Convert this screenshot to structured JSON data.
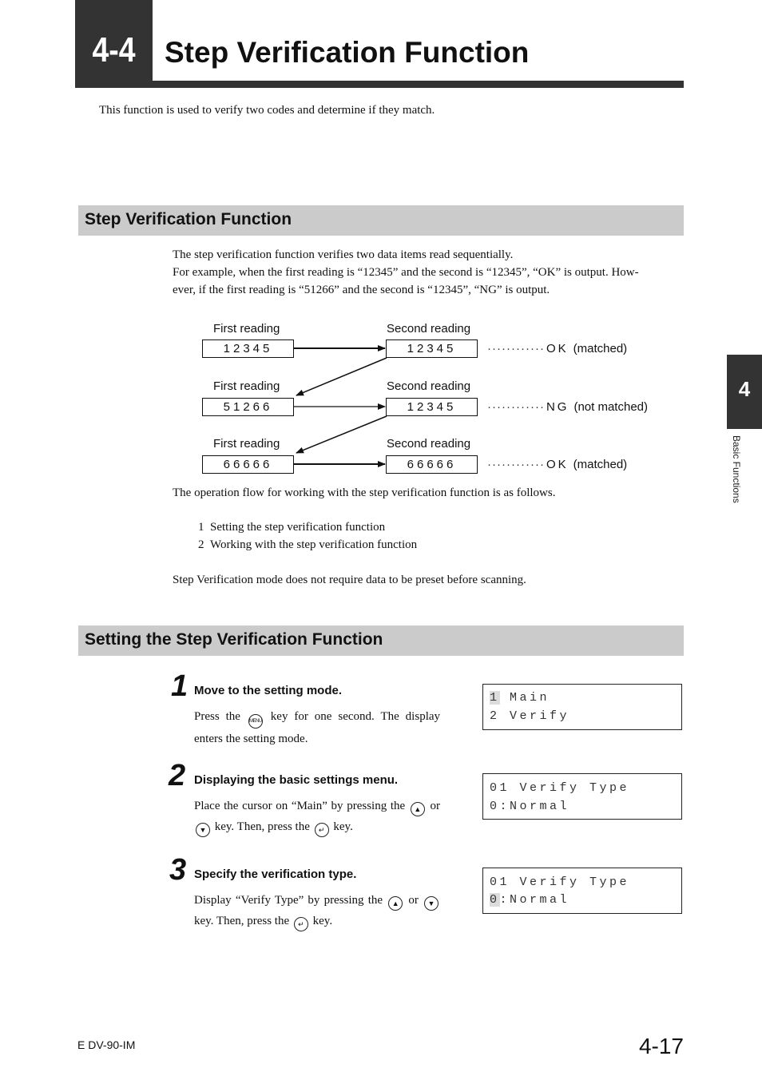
{
  "chapter": {
    "number": "4-4",
    "title": "Step Verification Function",
    "intro": "This function is used to verify two codes and determine if they match."
  },
  "section1": {
    "title": "Step Verification Function",
    "para_line1": "The step verification function verifies two data items read sequentially.",
    "para_line2": "For example, when the first reading is “12345” and the second is “12345”, “OK” is output. How-",
    "para_line3": "ever, if the first reading is “51266” and the second is “12345”, “NG” is output.",
    "diagram": {
      "first_label": "First reading",
      "second_label": "Second reading",
      "dots": "············",
      "rows": [
        {
          "first": "12345",
          "second": "12345",
          "result": "OK",
          "note": "(matched)"
        },
        {
          "first": "51266",
          "second": "12345",
          "result": "NG",
          "note": "(not matched)"
        },
        {
          "first": "66666",
          "second": "66666",
          "result": "OK",
          "note": "(matched)"
        }
      ]
    },
    "flow_intro": "The operation flow for working with the step verification function is as follows.",
    "flow_items": [
      {
        "num": "1",
        "text": "Setting the step verification function"
      },
      {
        "num": "2",
        "text": "Working with the step verification function"
      }
    ],
    "note": "Step Verification mode does not require data to be preset before scanning."
  },
  "section2": {
    "title": "Setting the Step Verification Function",
    "steps": [
      {
        "num": "1",
        "title": "Move to the setting mode.",
        "body_a": "Press the",
        "key1": "MENU",
        "body_b": "key for one second. The display enters the setting mode.",
        "lcd": {
          "line1_cursor": "1",
          "line1_rest": " Main",
          "line2": "2 Verify"
        }
      },
      {
        "num": "2",
        "title": "Displaying the basic settings menu.",
        "body_a": "Place the cursor on “Main” by pressing the",
        "key_up": "▲",
        "body_b": "or",
        "key_down": "▼",
        "body_c": "key. Then, press the",
        "key_enter": "↵",
        "body_d": "key.",
        "lcd": {
          "line1": "01 Verify Type",
          "line2": "0:Normal"
        }
      },
      {
        "num": "3",
        "title": "Specify the verification type.",
        "body_a": "Display “Verify Type” by pressing the",
        "key_up": "▲",
        "body_b": "or",
        "key_down": "▼",
        "body_c": "key. Then, press the",
        "key_enter": "↵",
        "body_d": "key.",
        "lcd": {
          "line1": "01 Verify Type",
          "line2_cursor": "0",
          "line2_rest": ":Normal"
        }
      }
    ]
  },
  "side_tab": {
    "number": "4",
    "label": "Basic Functions"
  },
  "footer": {
    "code": "E DV-90-IM",
    "page": "4-17"
  }
}
